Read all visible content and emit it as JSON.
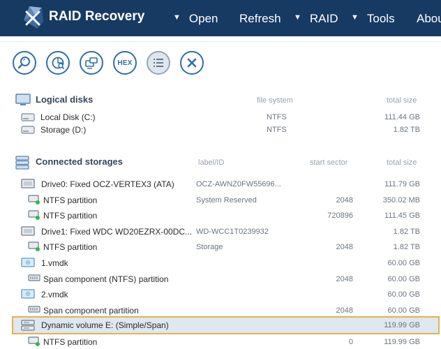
{
  "app": {
    "title": "RAID Recovery"
  },
  "menu": [
    {
      "label": "Open",
      "has_arrow": true
    },
    {
      "label": "Refresh",
      "has_arrow": false
    },
    {
      "label": "RAID",
      "has_arrow": true
    },
    {
      "label": "Tools",
      "has_arrow": true
    },
    {
      "label": "About",
      "has_arrow": false
    }
  ],
  "toolbar": [
    {
      "name": "search",
      "icon": "magnifier-icon"
    },
    {
      "name": "scan",
      "icon": "disk-scan-icon"
    },
    {
      "name": "image",
      "icon": "disk-image-icon"
    },
    {
      "name": "hex",
      "icon": "hex-icon",
      "label": "HEX"
    },
    {
      "name": "properties",
      "icon": "list-icon",
      "active": true
    },
    {
      "name": "close",
      "icon": "close-icon"
    }
  ],
  "logical": {
    "title": "Logical disks",
    "col_fs": "file system",
    "col_size": "total size",
    "rows": [
      {
        "name": "Local Disk (C:)",
        "fs": "NTFS",
        "size": "111.44 GB"
      },
      {
        "name": "Storage (D:)",
        "fs": "NTFS",
        "size": "1.82 TB"
      }
    ]
  },
  "connected": {
    "title": "Connected storages",
    "col_label": "label/ID",
    "col_start": "start sector",
    "col_size": "total size",
    "rows": [
      {
        "kind": "drive",
        "name": "Drive0: Fixed OCZ-VERTEX3 (ATA)",
        "label": "OCZ-AWNZ0FW55696...",
        "start": "",
        "size": "111.79 GB"
      },
      {
        "kind": "partition",
        "name": "NTFS partition",
        "label": "System Reserved",
        "start": "2048",
        "size": "350.02 MB"
      },
      {
        "kind": "partition",
        "name": "NTFS partition",
        "label": "",
        "start": "720896",
        "size": "111.45 GB"
      },
      {
        "kind": "drive",
        "name": "Drive1: Fixed WDC WD20EZRX-00DC...",
        "label": "WD-WCC1T0239932",
        "start": "",
        "size": "1.82 TB"
      },
      {
        "kind": "partition",
        "name": "NTFS partition",
        "label": "Storage",
        "start": "2048",
        "size": "1.82 TB"
      },
      {
        "kind": "vmdk",
        "name": "1.vmdk",
        "label": "",
        "start": "",
        "size": "60.00 GB"
      },
      {
        "kind": "span",
        "name": "Span component (NTFS) partition",
        "label": "",
        "start": "2048",
        "size": "60.00 GB"
      },
      {
        "kind": "vmdk",
        "name": "2.vmdk",
        "label": "",
        "start": "",
        "size": "60.00 GB"
      },
      {
        "kind": "span",
        "name": "Span component partition",
        "label": "",
        "start": "2048",
        "size": "60.00 GB"
      },
      {
        "kind": "volume",
        "name": "Dynamic volume E: (Simple/Span)",
        "label": "",
        "start": "",
        "size": "119.99 GB",
        "selected": true
      },
      {
        "kind": "partition",
        "name": "NTFS partition",
        "label": "",
        "start": "0",
        "size": "119.99 GB"
      }
    ]
  },
  "colors": {
    "topbar": "#173a63",
    "accent": "#2f6ea8",
    "selection_border": "#e6b24a",
    "selection_fill": "#dfe7f0"
  }
}
